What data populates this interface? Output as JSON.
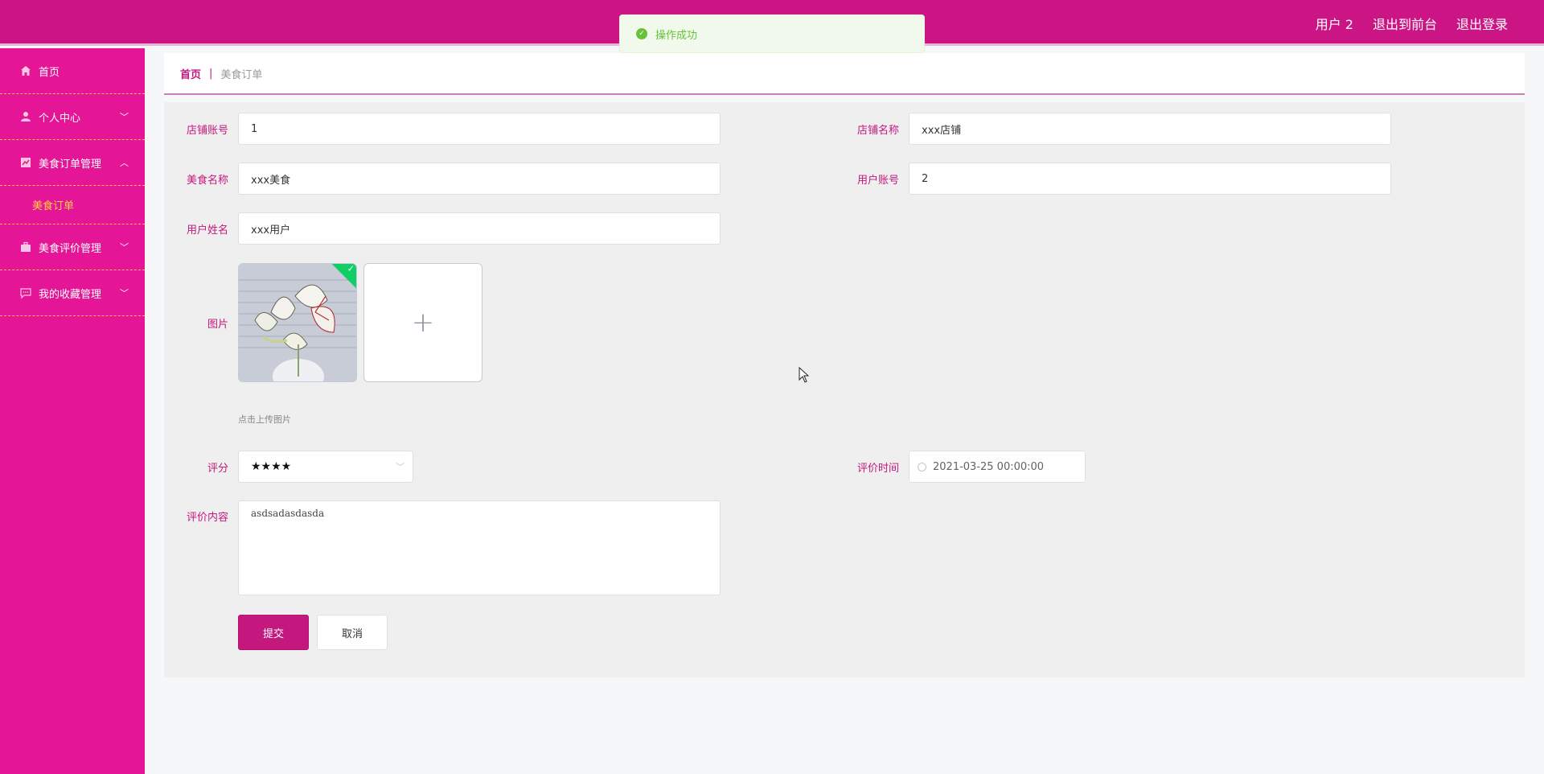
{
  "header": {
    "user": "用户 2",
    "to_front": "退出到前台",
    "logout": "退出登录"
  },
  "toast": {
    "message": "操作成功"
  },
  "sidebar": {
    "items": [
      {
        "label": "首页",
        "icon": "home-icon"
      },
      {
        "label": "个人中心",
        "icon": "user-icon"
      },
      {
        "label": "美食订单管理",
        "icon": "chart-icon"
      },
      {
        "label": "美食评价管理",
        "icon": "briefcase-icon"
      },
      {
        "label": "我的收藏管理",
        "icon": "chat-icon"
      }
    ],
    "sub_active": "美食订单"
  },
  "breadcrumb": {
    "home": "首页",
    "sep": "|",
    "current": "美食订单"
  },
  "form": {
    "shop_account_label": "店铺账号",
    "shop_account_value": "1",
    "shop_name_label": "店铺名称",
    "shop_name_value": "xxx店铺",
    "food_name_label": "美食名称",
    "food_name_value": "xxx美食",
    "user_account_label": "用户账号",
    "user_account_value": "2",
    "user_name_label": "用户姓名",
    "user_name_value": "xxx用户",
    "image_label": "图片",
    "upload_tip": "点击上传图片",
    "rating_label": "评分",
    "rating_value": "★★★★",
    "review_time_label": "评价时间",
    "review_time_value": "2021-03-25 00:00:00",
    "review_content_label": "评价内容",
    "review_content_value": "asdsadasdasda",
    "submit": "提交",
    "cancel": "取消"
  },
  "colors": {
    "topbar": "#cb1584",
    "sidebar": "#e41596",
    "accent": "#c4187f",
    "active_sub": "#ffd23f",
    "success": "#67c23a"
  }
}
